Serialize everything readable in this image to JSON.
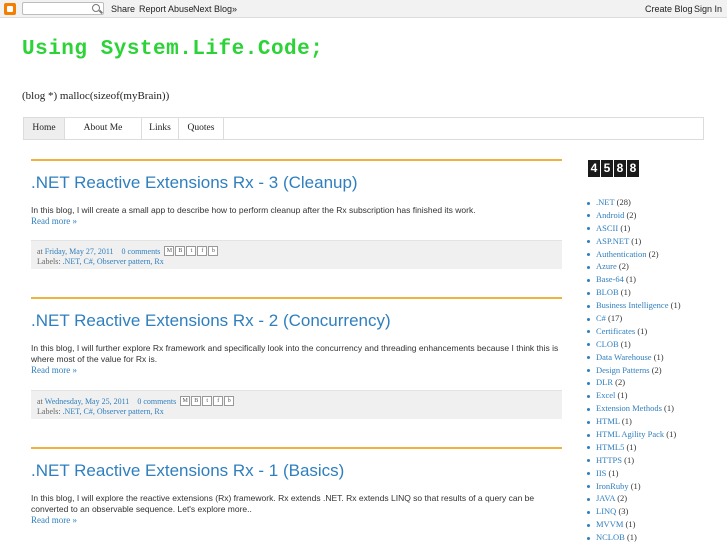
{
  "navbar": {
    "share": "Share",
    "report_abuse": "Report Abuse",
    "next_blog": "Next Blog»",
    "create_blog": "Create Blog",
    "sign_in": "Sign In"
  },
  "header": {
    "title": "Using System.Life.Code;",
    "description": "(blog *) malloc(sizeof(myBrain))"
  },
  "tabs": [
    "Home",
    "About Me",
    "Links",
    "Quotes"
  ],
  "posts": [
    {
      "title": ".NET Reactive Extensions Rx - 3 (Cleanup)",
      "body": "In this blog, I will create a small app to describe how to perform cleanup after the Rx subscription has finished its work.",
      "read_more": "Read more »",
      "at": "at",
      "date": "Friday, May 27, 2011",
      "comments": "0 comments",
      "labels_prefix": "Labels:",
      "labels": ".NET, C#, Observer pattern, Rx"
    },
    {
      "title": ".NET Reactive Extensions Rx - 2 (Concurrency)",
      "body": "In this blog, I will further explore Rx framework and specifically look into the concurrency and threading enhancements because I think this is where most of the value for Rx is.",
      "read_more": "Read more »",
      "at": "at",
      "date": "Wednesday, May 25, 2011",
      "comments": "0 comments",
      "labels_prefix": "Labels:",
      "labels": ".NET, C#, Observer pattern, Rx"
    },
    {
      "title": ".NET Reactive Extensions Rx - 1 (Basics)",
      "body": "In this blog, I will explore the reactive extensions (Rx) framework. Rx extends .NET. Rx extends LINQ so that results of a query can be converted to an observable sequence. Let's explore more..",
      "read_more": "Read more »"
    }
  ],
  "sidebar": {
    "counter": [
      "4",
      "5",
      "8",
      "8"
    ],
    "labels": [
      {
        "name": ".NET",
        "count": "(28)"
      },
      {
        "name": "Android",
        "count": "(2)"
      },
      {
        "name": "ASCII",
        "count": "(1)"
      },
      {
        "name": "ASP.NET",
        "count": "(1)"
      },
      {
        "name": "Authentication",
        "count": "(2)"
      },
      {
        "name": "Azure",
        "count": "(2)"
      },
      {
        "name": "Base-64",
        "count": "(1)"
      },
      {
        "name": "BLOB",
        "count": "(1)"
      },
      {
        "name": "Business Intelligence",
        "count": "(1)"
      },
      {
        "name": "C#",
        "count": "(17)"
      },
      {
        "name": "Certificates",
        "count": "(1)"
      },
      {
        "name": "CLOB",
        "count": "(1)"
      },
      {
        "name": "Data Warehouse",
        "count": "(1)"
      },
      {
        "name": "Design Patterns",
        "count": "(2)"
      },
      {
        "name": "DLR",
        "count": "(2)"
      },
      {
        "name": "Excel",
        "count": "(1)"
      },
      {
        "name": "Extension Methods",
        "count": "(1)"
      },
      {
        "name": "HTML",
        "count": "(1)"
      },
      {
        "name": "HTML Agility Pack",
        "count": "(1)"
      },
      {
        "name": "HTML5",
        "count": "(1)"
      },
      {
        "name": "HTTPS",
        "count": "(1)"
      },
      {
        "name": "IIS",
        "count": "(1)"
      },
      {
        "name": "IronRuby",
        "count": "(1)"
      },
      {
        "name": "JAVA",
        "count": "(2)"
      },
      {
        "name": "LINQ",
        "count": "(3)"
      },
      {
        "name": "MVVM",
        "count": "(1)"
      },
      {
        "name": "NCLOB",
        "count": "(1)"
      }
    ]
  }
}
